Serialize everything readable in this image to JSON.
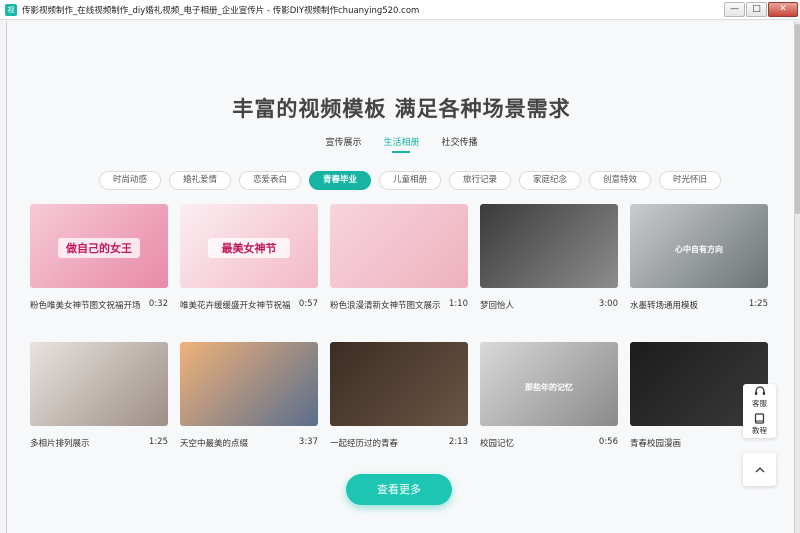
{
  "window": {
    "title": "传影视频制作_在线视频制作_diy婚礼视频_电子相册_企业宣传片 - 传影DIY视频制作chuanying520.com",
    "app_icon": "视",
    "min": "—",
    "max": "□",
    "close": "✕"
  },
  "headline": "丰富的视频模板 满足各种场景需求",
  "tabs": [
    {
      "label": "宣传展示",
      "active": false
    },
    {
      "label": "生活相册",
      "active": true
    },
    {
      "label": "社交传播",
      "active": false
    }
  ],
  "chips": [
    {
      "label": "时尚动感",
      "active": false
    },
    {
      "label": "婚礼爱情",
      "active": false
    },
    {
      "label": "恋爱表白",
      "active": false
    },
    {
      "label": "青春毕业",
      "active": true
    },
    {
      "label": "儿童相册",
      "active": false
    },
    {
      "label": "旅行记录",
      "active": false
    },
    {
      "label": "家庭纪念",
      "active": false
    },
    {
      "label": "创意特效",
      "active": false
    },
    {
      "label": "时光怀旧",
      "active": false
    }
  ],
  "cards": [
    {
      "caption": "粉色唯美女神节图文祝福开场",
      "duration": "0:32",
      "thumb_text": "做自己的女王",
      "colors": [
        "#f6c9d6",
        "#e98aa8"
      ]
    },
    {
      "caption": "唯美花卉缓缓盛开女神节祝福",
      "duration": "0:57",
      "thumb_text": "最美女神节",
      "colors": [
        "#fbeef2",
        "#f3b8c6"
      ]
    },
    {
      "caption": "粉色浪漫清新女神节图文展示",
      "duration": "1:10",
      "thumb_text": "",
      "colors": [
        "#f7d4dc",
        "#eeb1bf"
      ]
    },
    {
      "caption": "梦回怡人",
      "duration": "3:00",
      "thumb_text": "",
      "colors": [
        "#3a3a3a",
        "#8d8d8d"
      ]
    },
    {
      "caption": "水墨转场通用模板",
      "duration": "1:25",
      "thumb_text": "心中自有方向",
      "colors": [
        "#c8ccce",
        "#6d7375"
      ]
    },
    {
      "caption": "多相片排列展示",
      "duration": "1:25",
      "thumb_text": "",
      "colors": [
        "#e8e3df",
        "#9d8f86"
      ]
    },
    {
      "caption": "天空中最美的点缀",
      "duration": "3:37",
      "thumb_text": "",
      "colors": [
        "#f0b27a",
        "#5a6e8c"
      ]
    },
    {
      "caption": "一起经历过的青春",
      "duration": "2:13",
      "thumb_text": "",
      "colors": [
        "#3b2c22",
        "#6b5544"
      ]
    },
    {
      "caption": "校园记忆",
      "duration": "0:56",
      "thumb_text": "那些年的记忆",
      "colors": [
        "#d9d9d9",
        "#8a8a8a"
      ]
    },
    {
      "caption": "青春校园漫画",
      "duration": "",
      "thumb_text": "",
      "colors": [
        "#1c1c1c",
        "#3a3a3a"
      ]
    }
  ],
  "more_button": "查看更多",
  "side": {
    "service": "客服",
    "tutorial": "教程"
  },
  "accent": "#17b3a3"
}
